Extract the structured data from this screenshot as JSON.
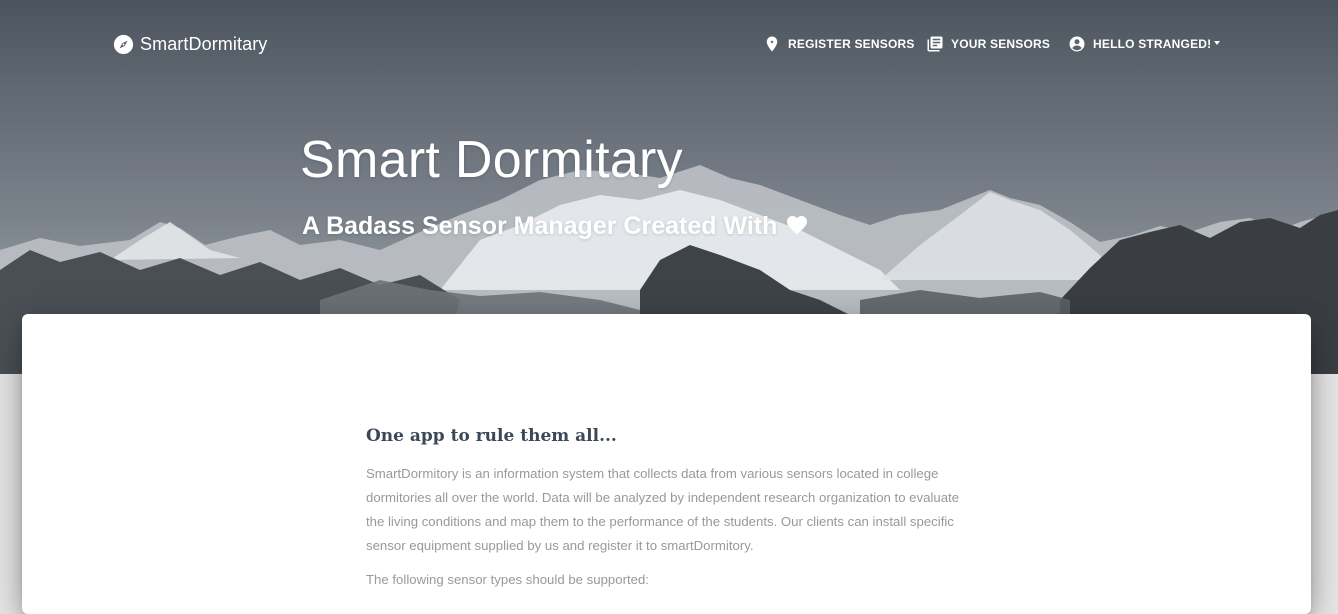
{
  "navbar": {
    "brand": "SmartDormitary",
    "brand_icon": "compass-icon",
    "items": [
      {
        "label": "REGISTER SENSORS",
        "icon": "map-pin-icon"
      },
      {
        "label": "YOUR SENSORS",
        "icon": "library-books-icon"
      },
      {
        "label": "HELLO STRANGED!",
        "icon": "account-circle-icon",
        "has_dropdown": true
      }
    ]
  },
  "hero": {
    "title": "Smart Dormitary",
    "subtitle": "A Badass Sensor Manager Created With",
    "subtitle_icon": "heart-icon"
  },
  "content": {
    "heading": "One app to rule them all...",
    "paragraph": "SmartDormitory is an information system that collects data from various sensors located in college dormitories all over the world. Data will be analyzed by independent research organization to evaluate the living conditions and map them to the performance of the students. Our clients can install specific sensor equipment supplied by us and register it to smartDormitory.",
    "paragraph2": "The following sensor types should be supported:"
  },
  "colors": {
    "heading": "#3c4858",
    "body_text": "#999999",
    "nav_text": "#ffffff",
    "card_background": "#ffffff",
    "page_background": "#e5e5e5"
  }
}
